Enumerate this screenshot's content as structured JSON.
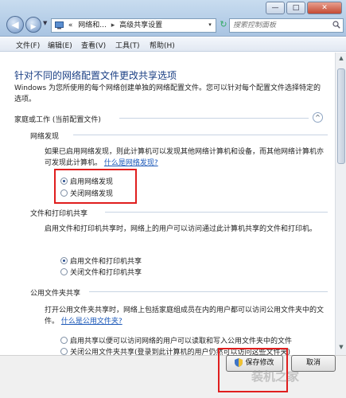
{
  "window": {
    "minimize": "—",
    "maximize": "□",
    "close": "✕"
  },
  "address_bar": {
    "icon": "network-icon",
    "chevron": "«",
    "crumb1": "网络和...",
    "crumb2": "高级共享设置",
    "separator": "▸",
    "dropdown": "▾",
    "refresh": "↻"
  },
  "search": {
    "placeholder": "搜索控制面板"
  },
  "menu": {
    "items": [
      "文件(F)",
      "编辑(E)",
      "查看(V)",
      "工具(T)",
      "帮助(H)"
    ]
  },
  "content": {
    "heading": "针对不同的网络配置文件更改共享选项",
    "intro": "Windows 为您所使用的每个网络创建单独的网络配置文件。您可以针对每个配置文件选择特定的选项。",
    "profile_title": "家庭或工作 (当前配置文件)",
    "collapse_icon": "^",
    "network_discovery": {
      "title": "网络发现",
      "desc": "如果已启用网络发现，则此计算机可以发现其他网络计算机和设备，而其他网络计算机亦可发现此计算机。",
      "link": "什么是网络发现?",
      "option_on": "启用网络发现",
      "option_off": "关闭网络发现",
      "selected": "on"
    },
    "file_printer_sharing": {
      "title": "文件和打印机共享",
      "desc": "启用文件和打印机共享时，网络上的用户可以访问通过此计算机共享的文件和打印机。",
      "option_on": "启用文件和打印机共享",
      "option_off": "关闭文件和打印机共享",
      "selected": "on"
    },
    "public_folder_sharing": {
      "title": "公用文件夹共享",
      "desc": "打开公用文件夹共享时，网络上包括家庭组成员在内的用户都可以访问公用文件夹中的文件。",
      "link": "什么是公用文件夹?",
      "option_on": "启用共享以便可以访问网络的用户可以读取和写入公用文件夹中的文件",
      "option_off": "关闭公用文件夹共享(登录到此计算机的用户仍然可以访问这些文件夹)"
    }
  },
  "footer": {
    "save_label": "保存修改",
    "cancel_label": "取消",
    "watermark": "装机之家"
  },
  "colors": {
    "highlight_box": "#e01e1e",
    "heading": "#1a3f84",
    "link": "#1a57b8"
  }
}
